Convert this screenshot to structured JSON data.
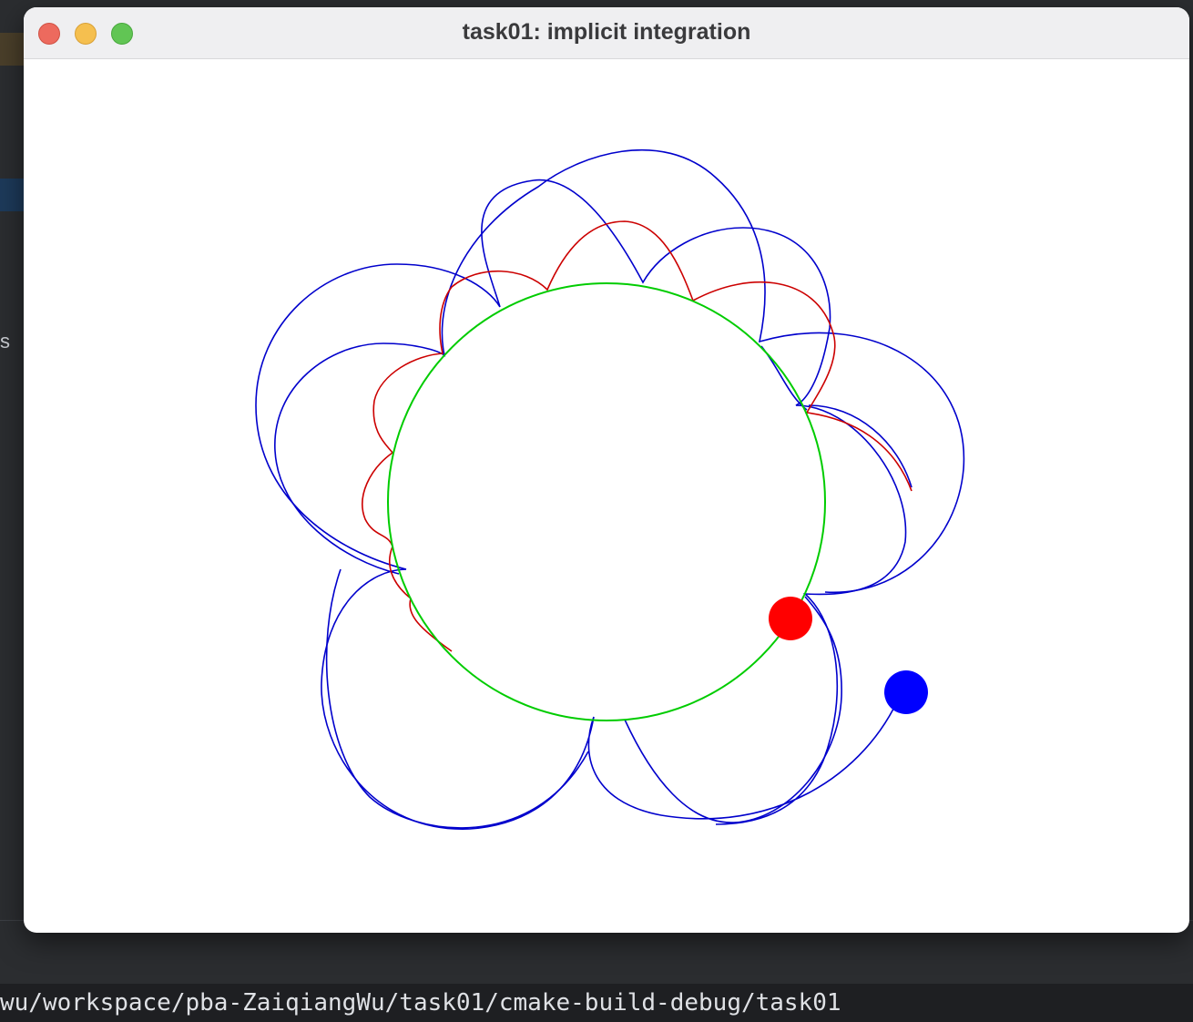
{
  "window": {
    "title": "task01: implicit integration"
  },
  "background_ide": {
    "side_letter": "s"
  },
  "terminal": {
    "path_text": "wu/workspace/pba-ZaiqiangWu/task01/cmake-build-debug/task01"
  },
  "colors": {
    "constraint_circle": "#00cc00",
    "red_trajectory": "#cc0000",
    "blue_trajectory": "#0000cc",
    "red_particle": "#ff0000",
    "blue_particle": "#0000ff"
  }
}
